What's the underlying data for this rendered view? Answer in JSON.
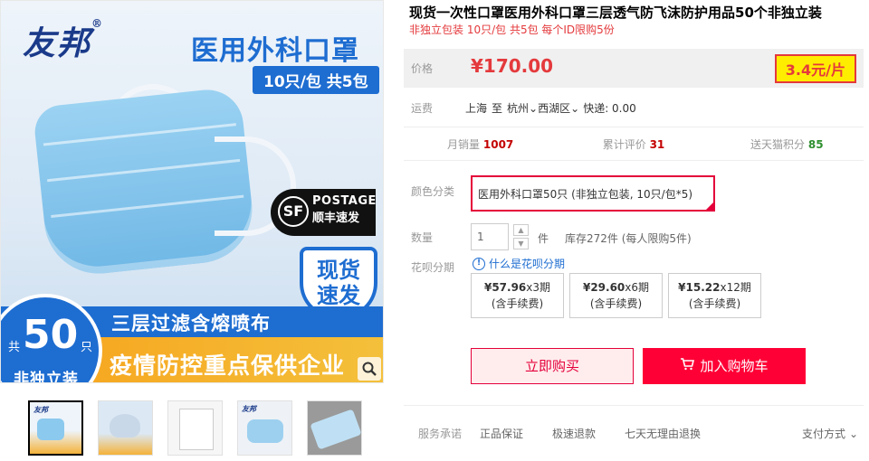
{
  "product_image": {
    "brand": "友邦",
    "brand_mark": "®",
    "headline": "医用外科口罩",
    "pack_tag": "10只/包 共5包",
    "sf_line1": "POSTAGE",
    "sf_line2": "顺丰速发",
    "sf_logo": "SF",
    "instock": "现货\n速发",
    "filter_text": "三层过滤含熔喷布",
    "epidemic_text": "疫情防控重点保供企业",
    "count_num": "50",
    "count_left": "共",
    "count_right": "只",
    "count_sub": "非独立装",
    "zoom_icon": "magnifier-icon"
  },
  "thumbnails": [
    {
      "label": "友邦",
      "active": true
    },
    {
      "label": "",
      "active": false
    },
    {
      "label": "",
      "active": false
    },
    {
      "label": "友邦",
      "active": false
    },
    {
      "label": "",
      "active": false
    }
  ],
  "product": {
    "title": "现货一次性口罩医用外科口罩三层透气防飞沫防护用品50个非独立装",
    "subtitle": "非独立包装 10只/包 共5包 每个ID限购5份",
    "price_label": "价格",
    "price": "¥170.00",
    "unit_price": "3.4元/片"
  },
  "shipping": {
    "label": "运费",
    "from": "上海",
    "to_word": "至",
    "city": "杭州",
    "district": "西湖区",
    "express": "快递: 0.00"
  },
  "stats": [
    {
      "label": "月销量",
      "value": "1007",
      "color": "#c40000"
    },
    {
      "label": "累计评价",
      "value": "31",
      "color": "#c40000"
    },
    {
      "label": "送天猫积分",
      "value": "85",
      "color": "#2f8f2f"
    }
  ],
  "color": {
    "label": "颜色分类",
    "selected": "医用外科口罩50只 (非独立包装, 10只/包*5)"
  },
  "quantity": {
    "label": "数量",
    "value": "1",
    "unit": "件",
    "stock": "库存272件 (每人限购5件)"
  },
  "huabei": {
    "label": "花呗分期",
    "help": "什么是花呗分期",
    "plans": [
      {
        "amount": "¥57.96",
        "periods": "x3期",
        "fee": "(含手续费)"
      },
      {
        "amount": "¥29.60",
        "periods": "x6期",
        "fee": "(含手续费)"
      },
      {
        "amount": "¥15.22",
        "periods": "x12期",
        "fee": "(含手续费)"
      }
    ]
  },
  "actions": {
    "buy_now": "立即购买",
    "add_cart": "加入购物车"
  },
  "service": {
    "label": "服务承诺",
    "items": [
      "正品保证",
      "极速退款",
      "七天无理由退换"
    ],
    "payment": "支付方式"
  },
  "colors": {
    "accent_red": "#e4003a",
    "price_red": "#e4393c",
    "brand_blue": "#1e6dd1"
  }
}
